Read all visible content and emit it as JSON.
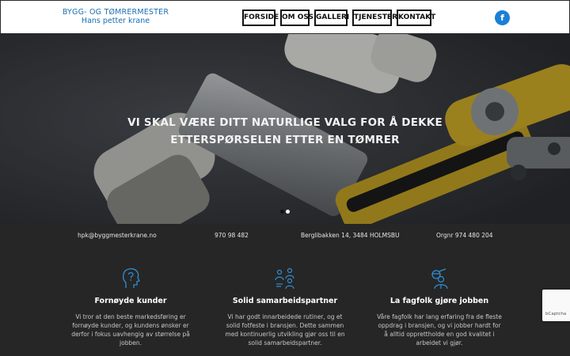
{
  "logo": {
    "line1": "BYGG- OG TØMRERMESTER",
    "line2": "Hans petter krane"
  },
  "nav": [
    "FORSIDE",
    "OM OSS",
    "GALLERI",
    "TJENESTER",
    "KONTAKT"
  ],
  "social": {
    "facebook_glyph": "f",
    "icon": "facebook-icon",
    "color": "#1a7fd6"
  },
  "hero": {
    "title_line1": "VI SKAL VÆRE DITT NATURLIGE VALG FOR Å DEKKE",
    "title_line2": "ETTERSPØRSELEN ETTER EN TØMRER",
    "slides": 2,
    "active_slide": 1
  },
  "contact": {
    "email": "hpk@byggmesterkrane.no",
    "phone": "970 98 482",
    "address": "Berglibakken 14, 3484 HOLMSBU",
    "orgnr": "Orgnr 974 480 204"
  },
  "features": [
    {
      "icon": "head-question-icon",
      "title": "Fornøyde kunder",
      "text": "Vi tror at den beste markedsføring er fornøyde kunder, og kundens ønsker er derfor i fokus uavhengig av størrelse på jobben."
    },
    {
      "icon": "team-meeting-icon",
      "title": "Solid samarbeidspartner",
      "text": "Vi har godt innarbeidede rutiner, og et solid fotfeste i bransjen. Dette sammen med kontinuerlig utvikling gjør oss til en solid samarbeidspartner."
    },
    {
      "icon": "worker-search-icon",
      "title": "La fagfolk gjøre jobben",
      "text": "Våre fagfolk har lang erfaring fra de fleste oppdrag i bransjen, og vi jobber hardt for å alltid opprettholde en god kvalitet i arbeidet vi gjør."
    }
  ],
  "recaptcha": {
    "label": "bCaptcha"
  },
  "colors": {
    "accent": "#1a7fd6",
    "icon_blue": "#2f8fd6",
    "dark_bg": "#262626"
  }
}
